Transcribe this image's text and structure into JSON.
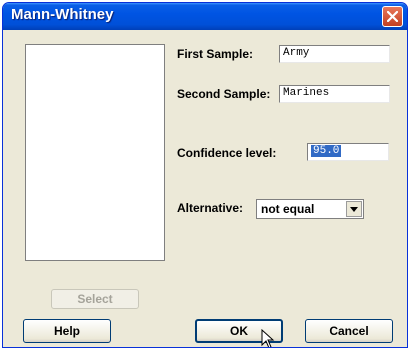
{
  "window": {
    "title": "Mann-Whitney"
  },
  "form": {
    "first_sample_label": "First Sample:",
    "first_sample_value": "Army",
    "second_sample_label": "Second Sample:",
    "second_sample_value": "Marines",
    "confidence_label": "Confidence level:",
    "confidence_value": "95.0",
    "alternative_label": "Alternative:",
    "alternative_value": "not equal"
  },
  "buttons": {
    "select": "Select",
    "help": "Help",
    "ok": "OK",
    "cancel": "Cancel"
  },
  "icons": {
    "close": "close-icon",
    "dropdown": "chevron-down-icon",
    "cursor": "mouse-pointer-icon"
  }
}
